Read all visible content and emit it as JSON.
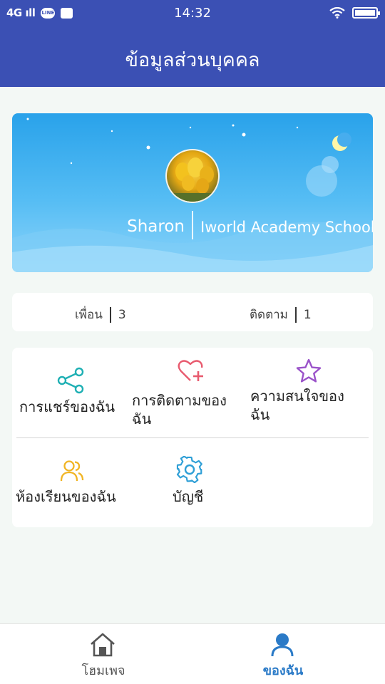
{
  "status_bar": {
    "network": "4G",
    "time": "14:32",
    "line_badge": "LINE"
  },
  "header": {
    "title": "ข้อมูลส่วนบุคคล"
  },
  "profile": {
    "name": "Sharon",
    "school": "Iworld Academy School"
  },
  "stats": {
    "friends_label": "เพื่อน",
    "friends_count": "3",
    "following_label": "ติดตาม",
    "following_count": "1"
  },
  "menu": {
    "share": "การแชร์ของฉัน",
    "following_line1": "การติดตามของ",
    "following_line2": "ฉัน",
    "interests_line1": "ความสนใจของ",
    "interests_line2": "ฉัน",
    "classroom": "ห้องเรียนของฉัน",
    "account": "บัญชี"
  },
  "tabs": {
    "home": "โฮมเพจ",
    "mine": "ของฉัน"
  },
  "colors": {
    "header": "#3b50b4",
    "share_icon": "#1fb0b4",
    "follow_icon": "#e85b6f",
    "star_icon": "#9a52c9",
    "class_icon": "#f1b525",
    "gear_icon": "#2f9fd6",
    "active_tab": "#2a7ac7",
    "inactive_tab": "#555555"
  }
}
